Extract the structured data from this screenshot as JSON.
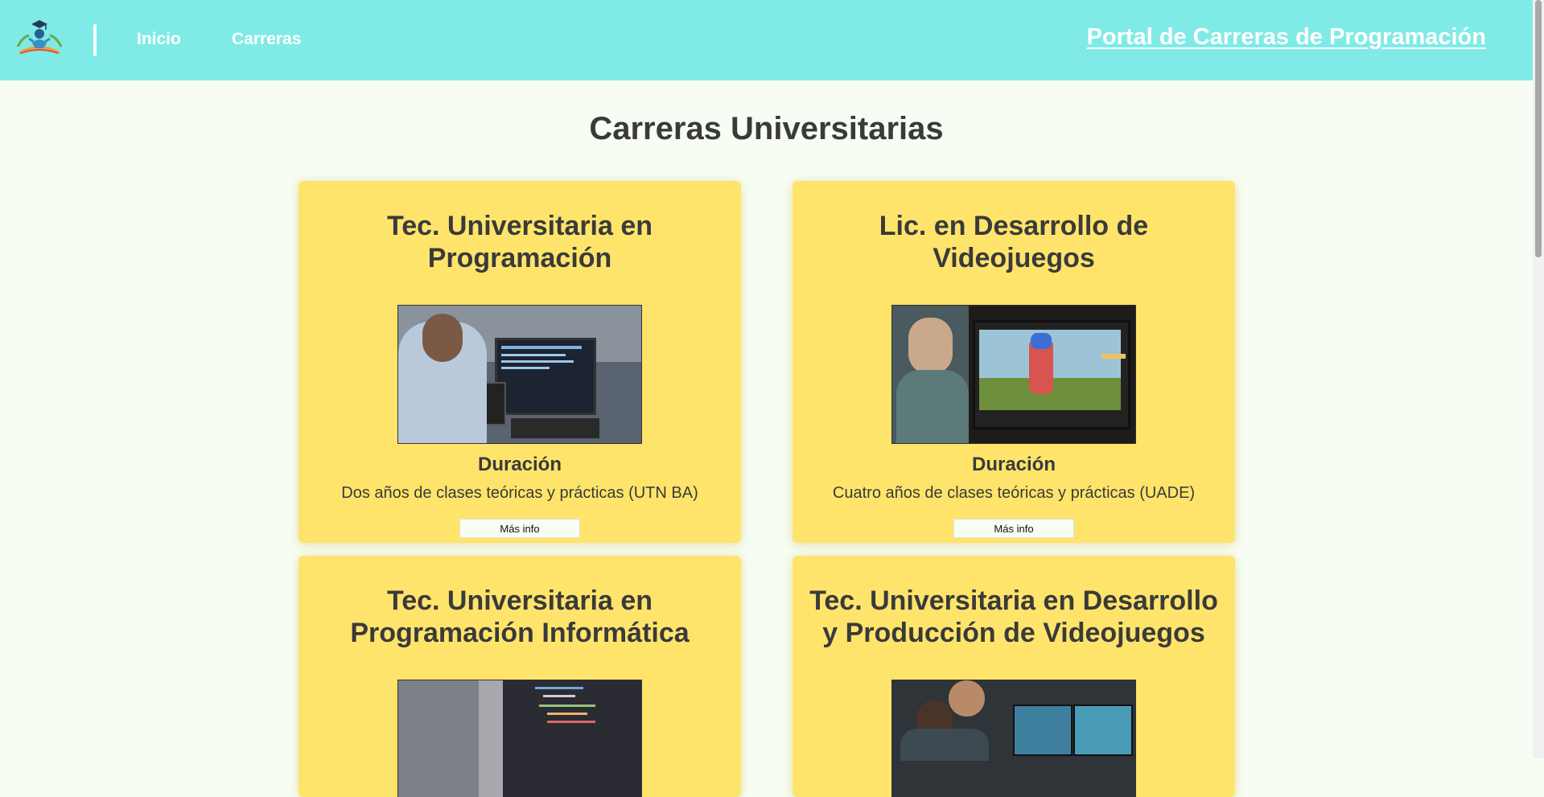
{
  "header": {
    "logo_icon": "graduate-book-logo",
    "nav": [
      {
        "label": "Inicio"
      },
      {
        "label": "Carreras"
      }
    ],
    "portal_title": "Portal de Carreras de Programación"
  },
  "main": {
    "heading": "Carreras Universitarias",
    "cards": [
      {
        "title": "Tec. Universitaria en Programación",
        "image": "programmer-at-desk-image",
        "subtitle": "Duración",
        "description": "Dos años de clases teóricas y prácticas (UTN BA)",
        "button": "Más info"
      },
      {
        "title": "Lic. en Desarrollo de Videojuegos",
        "image": "game-developer-monitor-image",
        "subtitle": "Duración",
        "description": "Cuatro años de clases teóricas y prácticas (UADE)",
        "button": "Más info"
      },
      {
        "title": "Tec. Universitaria en Programación Informática",
        "image": "code-on-screen-image",
        "subtitle": "",
        "description": "",
        "button": ""
      },
      {
        "title": "Tec. Universitaria en Desarrollo y Producción de Videojuegos",
        "image": "team-at-monitors-image",
        "subtitle": "",
        "description": "",
        "button": ""
      }
    ]
  },
  "colors": {
    "header_bg": "#80ebe6",
    "card_bg": "#ffe46b",
    "page_bg": "#f7fdf3"
  }
}
